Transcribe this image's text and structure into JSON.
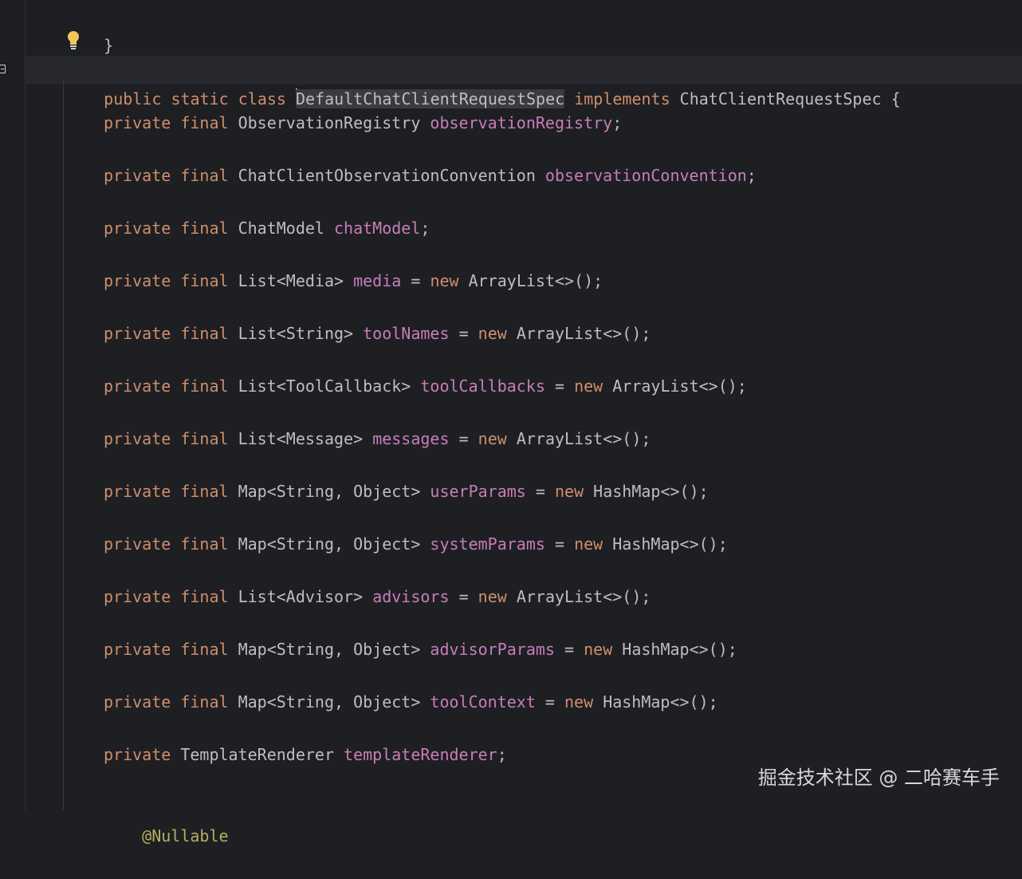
{
  "editor": {
    "closing_brace": "}",
    "class_decl": {
      "modifiers": "public static class",
      "class_name": "DefaultChatClientRequestSpec",
      "implements_kw": "implements",
      "interface_name": "ChatClientRequestSpec",
      "open_brace": "{"
    },
    "fields": [
      {
        "modifiers": "private final",
        "type": "ObservationRegistry",
        "name": "observationRegistry",
        "init_kw": "",
        "init": "",
        "end": ";"
      },
      {
        "modifiers": "private final",
        "type": "ChatClientObservationConvention",
        "name": "observationConvention",
        "init_kw": "",
        "init": "",
        "end": ";"
      },
      {
        "modifiers": "private final",
        "type": "ChatModel",
        "name": "chatModel",
        "init_kw": "",
        "init": "",
        "end": ";"
      },
      {
        "modifiers": "private final",
        "type": "List<Media>",
        "name": "media",
        "init_kw": "new",
        "init": "ArrayList<>()",
        "end": ";"
      },
      {
        "modifiers": "private final",
        "type": "List<String>",
        "name": "toolNames",
        "init_kw": "new",
        "init": "ArrayList<>()",
        "end": ";"
      },
      {
        "modifiers": "private final",
        "type": "List<ToolCallback>",
        "name": "toolCallbacks",
        "init_kw": "new",
        "init": "ArrayList<>()",
        "end": ";"
      },
      {
        "modifiers": "private final",
        "type": "List<Message>",
        "name": "messages",
        "init_kw": "new",
        "init": "ArrayList<>()",
        "end": ";"
      },
      {
        "modifiers": "private final",
        "type": "Map<String, Object>",
        "name": "userParams",
        "init_kw": "new",
        "init": "HashMap<>()",
        "end": ";"
      },
      {
        "modifiers": "private final",
        "type": "Map<String, Object>",
        "name": "systemParams",
        "init_kw": "new",
        "init": "HashMap<>()",
        "end": ";"
      },
      {
        "modifiers": "private final",
        "type": "List<Advisor>",
        "name": "advisors",
        "init_kw": "new",
        "init": "ArrayList<>()",
        "end": ";"
      },
      {
        "modifiers": "private final",
        "type": "Map<String, Object>",
        "name": "advisorParams",
        "init_kw": "new",
        "init": "HashMap<>()",
        "end": ";"
      },
      {
        "modifiers": "private final",
        "type": "Map<String, Object>",
        "name": "toolContext",
        "init_kw": "new",
        "init": "HashMap<>()",
        "end": ";"
      },
      {
        "modifiers": "private",
        "type": "TemplateRenderer",
        "name": "templateRenderer",
        "init_kw": "",
        "init": "",
        "end": ";"
      }
    ],
    "annotation": "@Nullable"
  },
  "watermark": "掘金技术社区 @ 二哈赛车手",
  "colors": {
    "background": "#1e1f22",
    "keyword": "#cf8e6d",
    "field": "#c77dbb",
    "text": "#bcbec4",
    "annotation": "#b3ae60",
    "bulb": "#f2c55c"
  },
  "icons": [
    "fold-marker-icon",
    "lightbulb-icon"
  ]
}
